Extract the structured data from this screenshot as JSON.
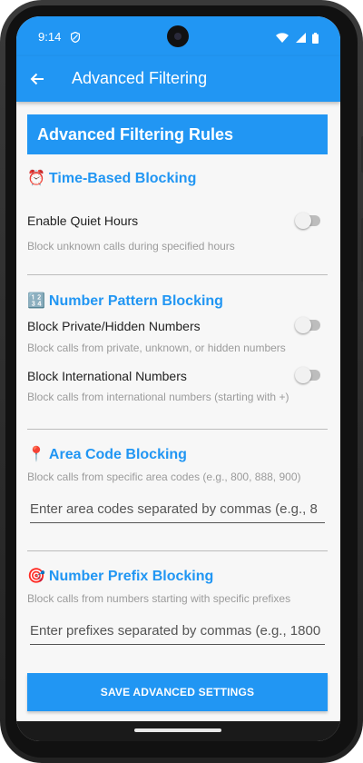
{
  "status_bar": {
    "time": "9:14"
  },
  "toolbar": {
    "title": "Advanced Filtering"
  },
  "banner": {
    "title": "Advanced Filtering Rules"
  },
  "sections": {
    "time": {
      "emoji": "⏰",
      "title": "Time-Based Blocking",
      "quiet_hours_label": "Enable Quiet Hours",
      "quiet_hours_desc": "Block unknown calls during specified hours",
      "quiet_hours_enabled": false
    },
    "pattern": {
      "emoji": "🔢",
      "title": "Number Pattern Blocking",
      "private_label": "Block Private/Hidden Numbers",
      "private_desc": "Block calls from private, unknown, or hidden numbers",
      "private_enabled": false,
      "intl_label": "Block International Numbers",
      "intl_desc": "Block calls from international numbers (starting with +)",
      "intl_enabled": false
    },
    "area": {
      "emoji": "📍",
      "title": "Area Code Blocking",
      "desc": "Block calls from specific area codes (e.g., 800, 888, 900)",
      "input_value": "",
      "input_placeholder": "Enter area codes separated by commas (e.g., 8"
    },
    "prefix": {
      "emoji": "🎯",
      "title": "Number Prefix Blocking",
      "desc": "Block calls from numbers starting with specific prefixes",
      "input_value": "",
      "input_placeholder": "Enter prefixes separated by commas (e.g., 1800"
    }
  },
  "save_button": {
    "label": "SAVE ADVANCED SETTINGS"
  },
  "colors": {
    "accent": "#2196f3",
    "toggle_off": "#bdbdbd",
    "description": "#9b9b9b"
  }
}
